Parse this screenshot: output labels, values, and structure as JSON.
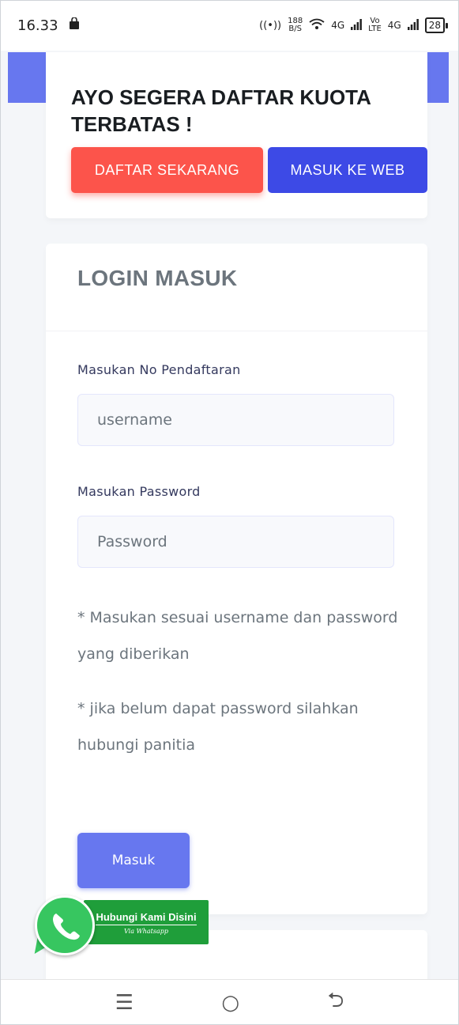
{
  "status_bar": {
    "time": "16.33",
    "data_speed_value": "188",
    "data_speed_unit": "B/S",
    "network_1": "4G",
    "volte_top": "Vo",
    "volte_bottom": "LTE",
    "network_2": "4G",
    "battery": "28"
  },
  "promo": {
    "headline": "AYO SEGERA DAFTAR KUOTA TERBATAS !",
    "register_button": "DAFTAR SEKARANG",
    "web_button": "MASUK KE WEB"
  },
  "login": {
    "title": "LOGIN MASUK",
    "registration_label": "Masukan No Pendaftaran",
    "username_placeholder": "username",
    "password_label": "Masukan Password",
    "password_placeholder": "Password",
    "note_1": "* Masukan sesuai username dan password yang diberikan",
    "note_2": "* jika belum dapat password silahkan hubungi panitia",
    "submit_button": "Masuk"
  },
  "whatsapp_widget": {
    "title": "Hubungi Kami Disini",
    "subtitle": "Via Whatsapp"
  },
  "navigation": {
    "menu_icon": "menu-icon",
    "home_icon": "home-circle-icon",
    "back_icon": "back-arrow-icon"
  },
  "colors": {
    "primary": "#6777ef",
    "danger": "#fc544b",
    "web_button": "#3d4ae6",
    "whatsapp": "#37c660"
  }
}
